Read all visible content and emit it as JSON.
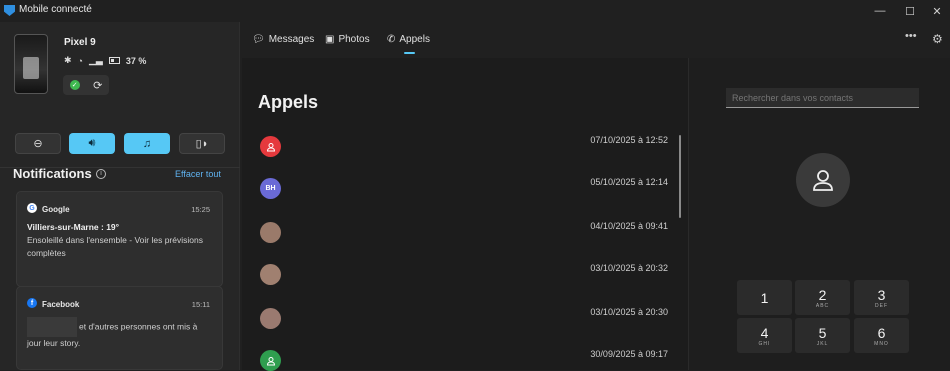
{
  "app": {
    "title": "Mobile connecté",
    "minimize": "—",
    "maximize": "☐",
    "close": "✕"
  },
  "device": {
    "name": "Pixel 9",
    "battery": "37 %"
  },
  "notifications": {
    "title": "Notifications",
    "clear_all": "Effacer tout",
    "items": [
      {
        "source": "Google",
        "time": "15:25",
        "headline": "Villiers-sur-Marne : 19°",
        "body": "Ensoleillé dans l'ensemble - Voir les prévisions complètes"
      },
      {
        "source": "Facebook",
        "time": "15:11",
        "body": "et d'autres personnes ont mis à jour leur story."
      }
    ]
  },
  "tabs": [
    {
      "label": "Messages",
      "active": false
    },
    {
      "label": "Photos",
      "active": false
    },
    {
      "label": "Appels",
      "active": true
    }
  ],
  "calls": {
    "title": "Appels",
    "rows": [
      {
        "avatar": "",
        "color": "#e5393d",
        "date": "07/10/2025 à 12:52"
      },
      {
        "avatar": "BH",
        "color": "#6a6ad6",
        "date": "05/10/2025 à 12:14"
      },
      {
        "avatar": "",
        "color": "#9a7a6a",
        "date": "04/10/2025 à 09:41"
      },
      {
        "avatar": "",
        "color": "#a08070",
        "date": "03/10/2025 à 20:32"
      },
      {
        "avatar": "",
        "color": "#9a7a70",
        "date": "03/10/2025 à 20:30"
      },
      {
        "avatar": "",
        "color": "#2f9e4f",
        "date": "30/09/2025 à 09:17"
      }
    ]
  },
  "dialpad": {
    "search_placeholder": "Rechercher dans vos contacts",
    "keys": [
      {
        "digit": "1",
        "letters": ""
      },
      {
        "digit": "2",
        "letters": "ABC"
      },
      {
        "digit": "3",
        "letters": "DEF"
      },
      {
        "digit": "4",
        "letters": "GHI"
      },
      {
        "digit": "5",
        "letters": "JKL"
      },
      {
        "digit": "6",
        "letters": "MNO"
      }
    ]
  },
  "colors": {
    "accent": "#56c8f5",
    "link": "#5fb2f0"
  }
}
